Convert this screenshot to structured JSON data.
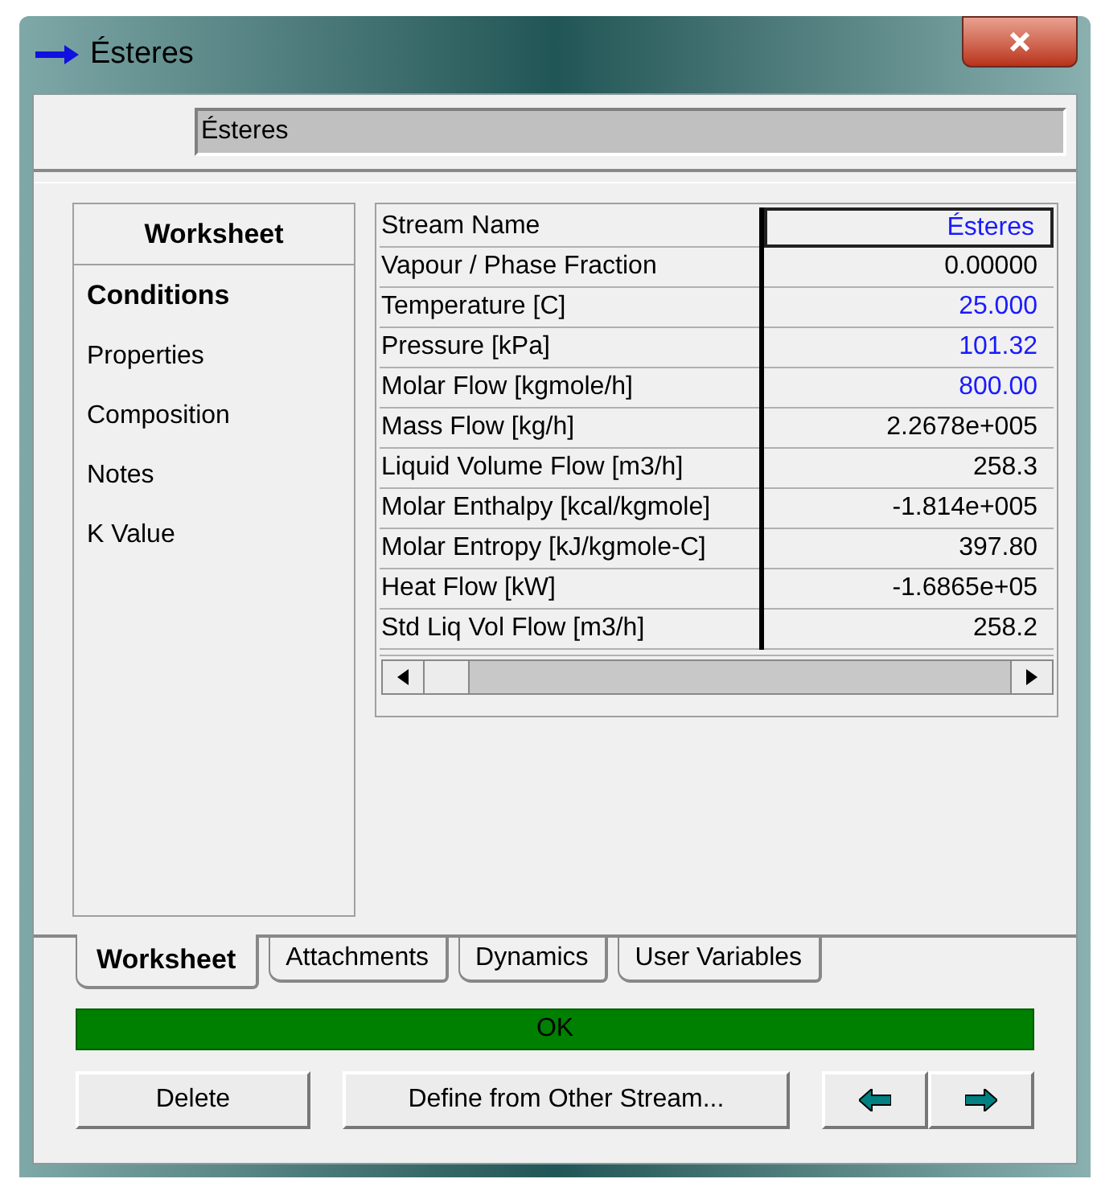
{
  "window": {
    "title": "Ésteres"
  },
  "name_field": {
    "value": "Ésteres"
  },
  "sidebar": {
    "title": "Worksheet",
    "items": [
      {
        "label": "Conditions",
        "selected": true
      },
      {
        "label": "Properties",
        "selected": false
      },
      {
        "label": "Composition",
        "selected": false
      },
      {
        "label": "Notes",
        "selected": false
      },
      {
        "label": "K Value",
        "selected": false
      }
    ]
  },
  "table": {
    "rows": [
      {
        "label": "Stream Name",
        "value": "Ésteres",
        "specified": true,
        "selected": true
      },
      {
        "label": "Vapour / Phase Fraction",
        "value": "0.00000",
        "specified": false,
        "selected": false
      },
      {
        "label": "Temperature [C]",
        "value": "25.000",
        "specified": true,
        "selected": false
      },
      {
        "label": "Pressure [kPa]",
        "value": "101.32",
        "specified": true,
        "selected": false
      },
      {
        "label": "Molar Flow [kgmole/h]",
        "value": "800.00",
        "specified": true,
        "selected": false
      },
      {
        "label": "Mass Flow [kg/h]",
        "value": "2.2678e+005",
        "specified": false,
        "selected": false
      },
      {
        "label": "Liquid Volume Flow [m3/h]",
        "value": "258.3",
        "specified": false,
        "selected": false
      },
      {
        "label": "Molar Enthalpy [kcal/kgmole]",
        "value": "-1.814e+005",
        "specified": false,
        "selected": false
      },
      {
        "label": "Molar Entropy [kJ/kgmole-C]",
        "value": "397.80",
        "specified": false,
        "selected": false
      },
      {
        "label": "Heat Flow [kW]",
        "value": "-1.6865e+05",
        "specified": false,
        "selected": false
      },
      {
        "label": "Std Liq Vol Flow [m3/h]",
        "value": "258.2",
        "specified": false,
        "selected": false
      }
    ]
  },
  "tabs": [
    {
      "label": "Worksheet",
      "selected": true
    },
    {
      "label": "Attachments",
      "selected": false
    },
    {
      "label": "Dynamics",
      "selected": false
    },
    {
      "label": "User Variables",
      "selected": false
    }
  ],
  "status_bar": {
    "text": "OK"
  },
  "buttons": [
    {
      "label": "Delete"
    },
    {
      "label": "Define from Other Stream..."
    }
  ]
}
